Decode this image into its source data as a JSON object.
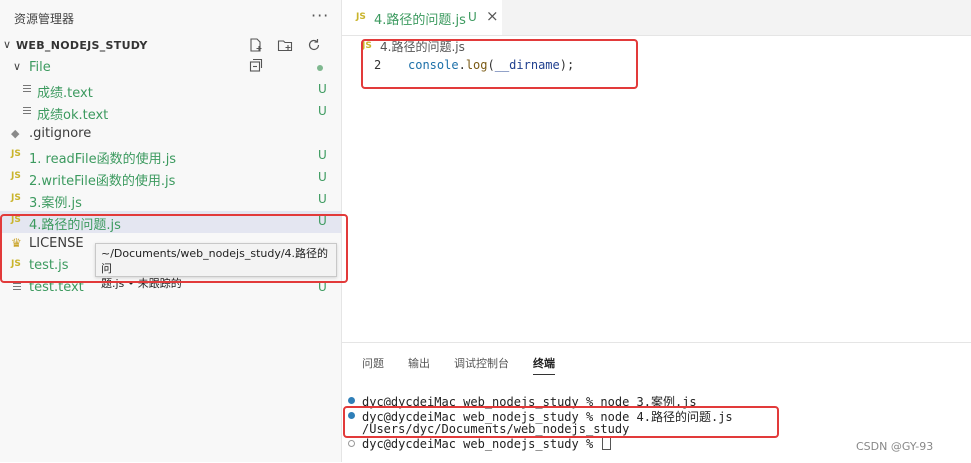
{
  "sidebar": {
    "header": "资源管理器",
    "more": "···",
    "project": "WEB_NODEJS_STUDY",
    "items": [
      {
        "icon": "folder-open",
        "label": "File",
        "badge": "",
        "dot": true
      },
      {
        "icon": "lines",
        "label": "成绩.text",
        "badge": "U"
      },
      {
        "icon": "lines",
        "label": "成绩ok.text",
        "badge": "U"
      },
      {
        "icon": "git",
        "label": ".gitignore",
        "badge": ""
      },
      {
        "icon": "JS",
        "label": "1. readFile函数的使用.js",
        "badge": "U"
      },
      {
        "icon": "JS",
        "label": "2.writeFile函数的使用.js",
        "badge": "U"
      },
      {
        "icon": "JS",
        "label": "3.案例.js",
        "badge": "U"
      },
      {
        "icon": "JS",
        "label": "4.路径的问题.js",
        "badge": "U"
      },
      {
        "icon": "license",
        "label": "LICENSE",
        "badge": ""
      },
      {
        "icon": "JS",
        "label": "test.js",
        "badge": ""
      },
      {
        "icon": "lines",
        "label": "test.text",
        "badge": "U"
      }
    ],
    "tooltip_line1": "~/Documents/web_nodejs_study/4.路径的问",
    "tooltip_line2": "题.js • 未跟踪的"
  },
  "editor": {
    "tab": {
      "icon": "JS",
      "name": "4.路径的问题.js",
      "status": "U",
      "close": "×"
    },
    "breadcrumb": "4.路径的问题.js",
    "line_number": "2",
    "code": {
      "obj": "console",
      "dot": ".",
      "fn": "log",
      "open": "(",
      "var": "__dirname",
      "close": ");"
    }
  },
  "panel": {
    "tabs": [
      "问题",
      "输出",
      "调试控制台",
      "终端"
    ],
    "active_tab": "终端",
    "terminal": [
      "dyc@dycdeiMac web_nodejs_study % node 3.案例.js",
      "dyc@dycdeiMac web_nodejs_study % node 4.路径的问题.js",
      "/Users/dyc/Documents/web_nodejs_study",
      "dyc@dycdeiMac web_nodejs_study % "
    ]
  },
  "watermark": "CSDN @GY-93",
  "colors": {
    "accent_red": "#e23a3a",
    "untracked_green": "#3c9a5f",
    "js_yellow": "#c9b42b"
  }
}
